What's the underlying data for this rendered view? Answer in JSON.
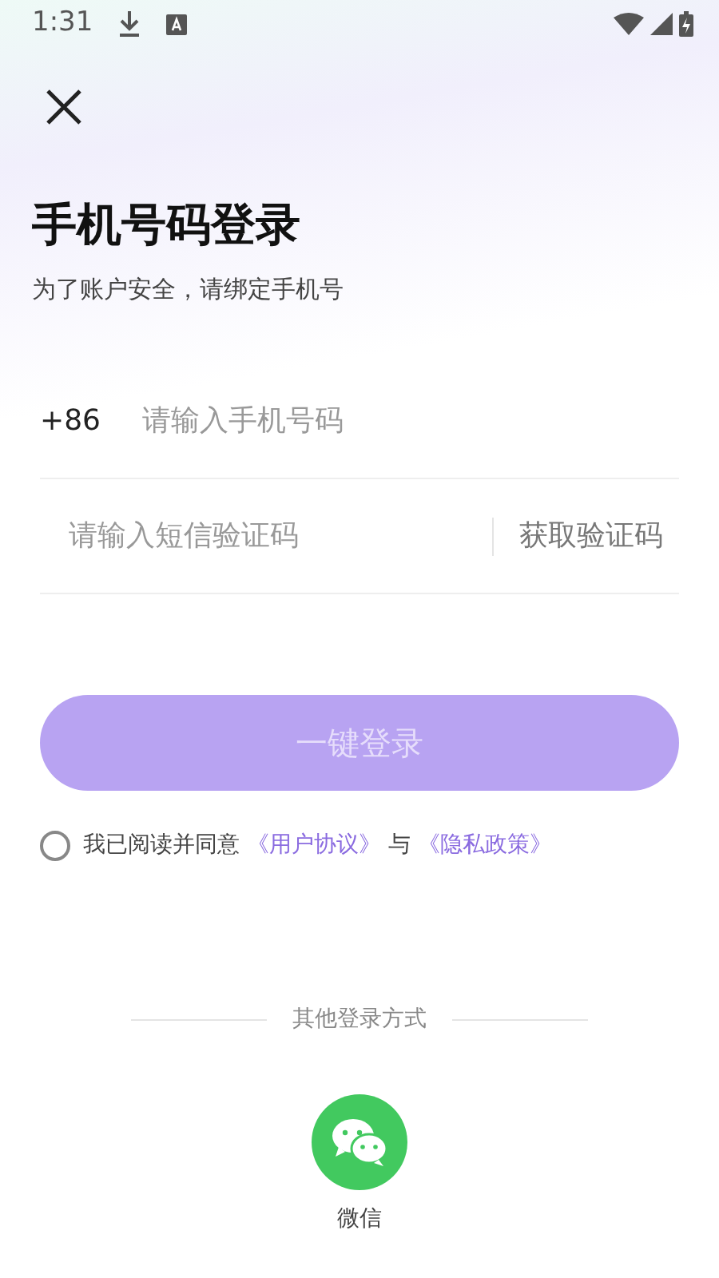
{
  "status_bar": {
    "time": "1:31"
  },
  "title": "手机号码登录",
  "subtitle": "为了账户安全，请绑定手机号",
  "phone": {
    "prefix": "+86",
    "placeholder": "请输入手机号码"
  },
  "code": {
    "placeholder": "请输入短信验证码",
    "button": "获取验证码"
  },
  "login_button": {
    "label": "一键登录",
    "disabled": true
  },
  "agreement": {
    "checked": false,
    "text": "我已阅读并同意",
    "link_1": "《用户协议》",
    "joiner": "与",
    "link_2": "《隐私政策》"
  },
  "other_login": {
    "label": "其他登录方式",
    "methods": [
      {
        "label": "微信"
      }
    ]
  }
}
